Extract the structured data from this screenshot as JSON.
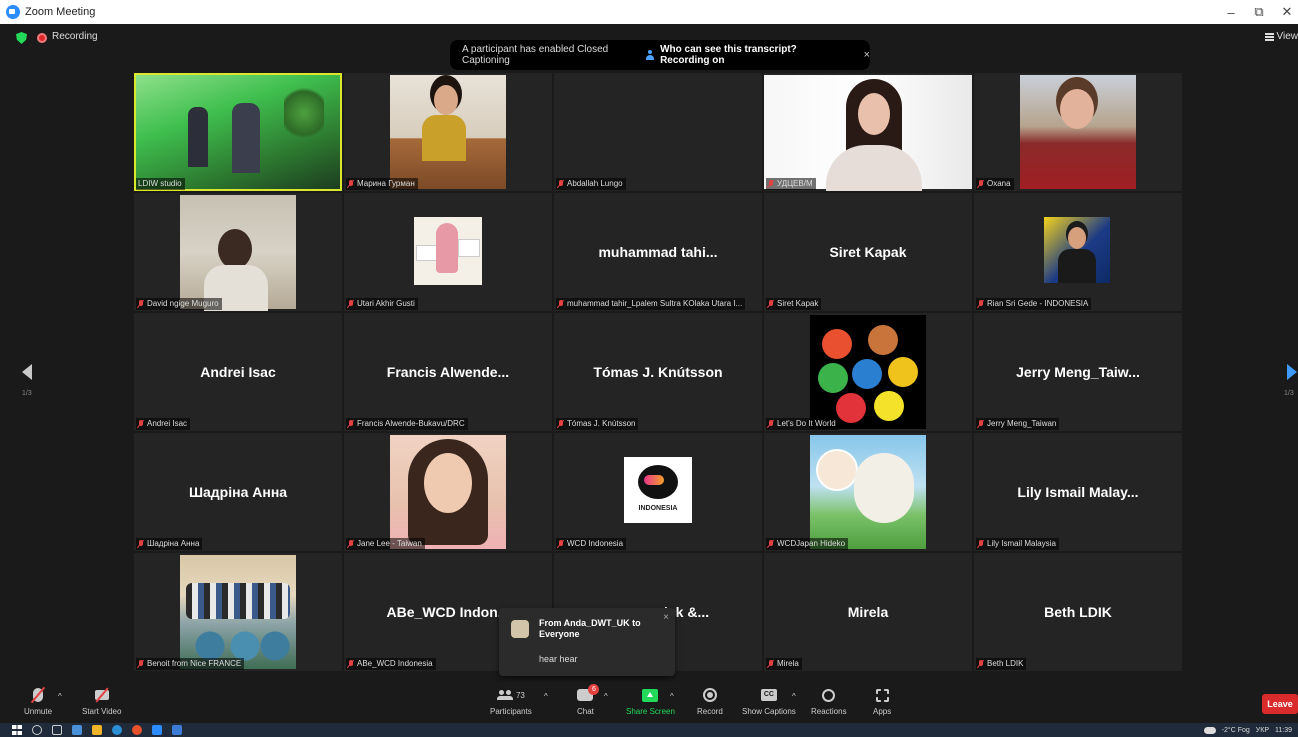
{
  "window": {
    "title": "Zoom Meeting",
    "minimize": "–",
    "restore": "⧉",
    "close": "✕"
  },
  "topbar": {
    "recording": "Recording",
    "view": "View"
  },
  "cc_banner": {
    "message": "A participant has enabled Closed Captioning",
    "link": "Who can see this transcript? Recording on",
    "close": "×"
  },
  "tiles": [
    {
      "label": "LDIW studio",
      "big": "",
      "muted": false
    },
    {
      "label": "Марина Гурман",
      "big": "",
      "muted": true
    },
    {
      "label": "Abdallah Lungo",
      "big": "",
      "muted": true
    },
    {
      "label": "УДЦЕВ/М",
      "big": "",
      "muted": true
    },
    {
      "label": "Oxana",
      "big": "",
      "muted": true
    },
    {
      "label": "David ngige Muguro",
      "big": "",
      "muted": true
    },
    {
      "label": "Utari Akhir Gusti",
      "big": "",
      "muted": true
    },
    {
      "label": "muhammad tahir_Lpalem Sultra KOlaka Utara I...",
      "big": "muhammad  tahi...",
      "muted": true
    },
    {
      "label": "Siret Kapak",
      "big": "Siret Kapak",
      "muted": true
    },
    {
      "label": "Rian Sri Gede - INDONESIA",
      "big": "",
      "muted": true
    },
    {
      "label": "Andrei Isac",
      "big": "Andrei Isac",
      "muted": true
    },
    {
      "label": "Francis Alwende-Bukavu/DRC",
      "big": "Francis  Alwende...",
      "muted": true
    },
    {
      "label": "Tómas J. Knútsson",
      "big": "Tómas J. Knútsson",
      "muted": true
    },
    {
      "label": "Let's Do It World",
      "big": "",
      "muted": true
    },
    {
      "label": "Jerry Meng_Taiwan",
      "big": "Jerry  Meng_Taiw...",
      "muted": true
    },
    {
      "label": "Шадріна Анна",
      "big": "Шадріна Анна",
      "muted": true
    },
    {
      "label": "Jane Lee - Taiwan",
      "big": "",
      "muted": true
    },
    {
      "label": "WCD Indonesia",
      "big": "",
      "muted": true
    },
    {
      "label": "WCDJapan Hideko",
      "big": "",
      "muted": true
    },
    {
      "label": "Lily Ismail Malaysia",
      "big": "Lily  Ismail  Malay...",
      "muted": true
    },
    {
      "label": "Benoit from Nice FRANCE",
      "big": "",
      "muted": true
    },
    {
      "label": "ABe_WCD Indonesia",
      "big": "ABe_WCD  Indon...",
      "muted": true
    },
    {
      "label": "",
      "big": "ick &...",
      "muted": false
    },
    {
      "label": "Mirela",
      "big": "Mirela",
      "muted": true
    },
    {
      "label": "Beth LDIK",
      "big": "Beth LDIK",
      "muted": true
    }
  ],
  "wcd_logo_text": "INDONESIA",
  "chat_popup": {
    "from": "From Anda_DWT_UK to Everyone",
    "message": "hear hear",
    "close": "×"
  },
  "pagination": {
    "left": "1/3",
    "right": "1/3"
  },
  "toolbar": {
    "unmute": "Unmute",
    "start_video": "Start Video",
    "participants": "Participants",
    "participants_count": "73",
    "chat": "Chat",
    "chat_badge": "6",
    "share_screen": "Share Screen",
    "record": "Record",
    "show_captions": "Show Captions",
    "captions_icon_text": "CC",
    "reactions": "Reactions",
    "apps": "Apps",
    "leave": "Leave",
    "caret": "^"
  },
  "taskbar": {
    "weather": "-2°C Fog",
    "lang": "УКР",
    "time": "11:39"
  },
  "colors": {
    "accent_blue": "#2d8cff",
    "share_green": "#23d959",
    "leave_red": "#d92b2b",
    "active_speaker": "#d9e82c"
  }
}
